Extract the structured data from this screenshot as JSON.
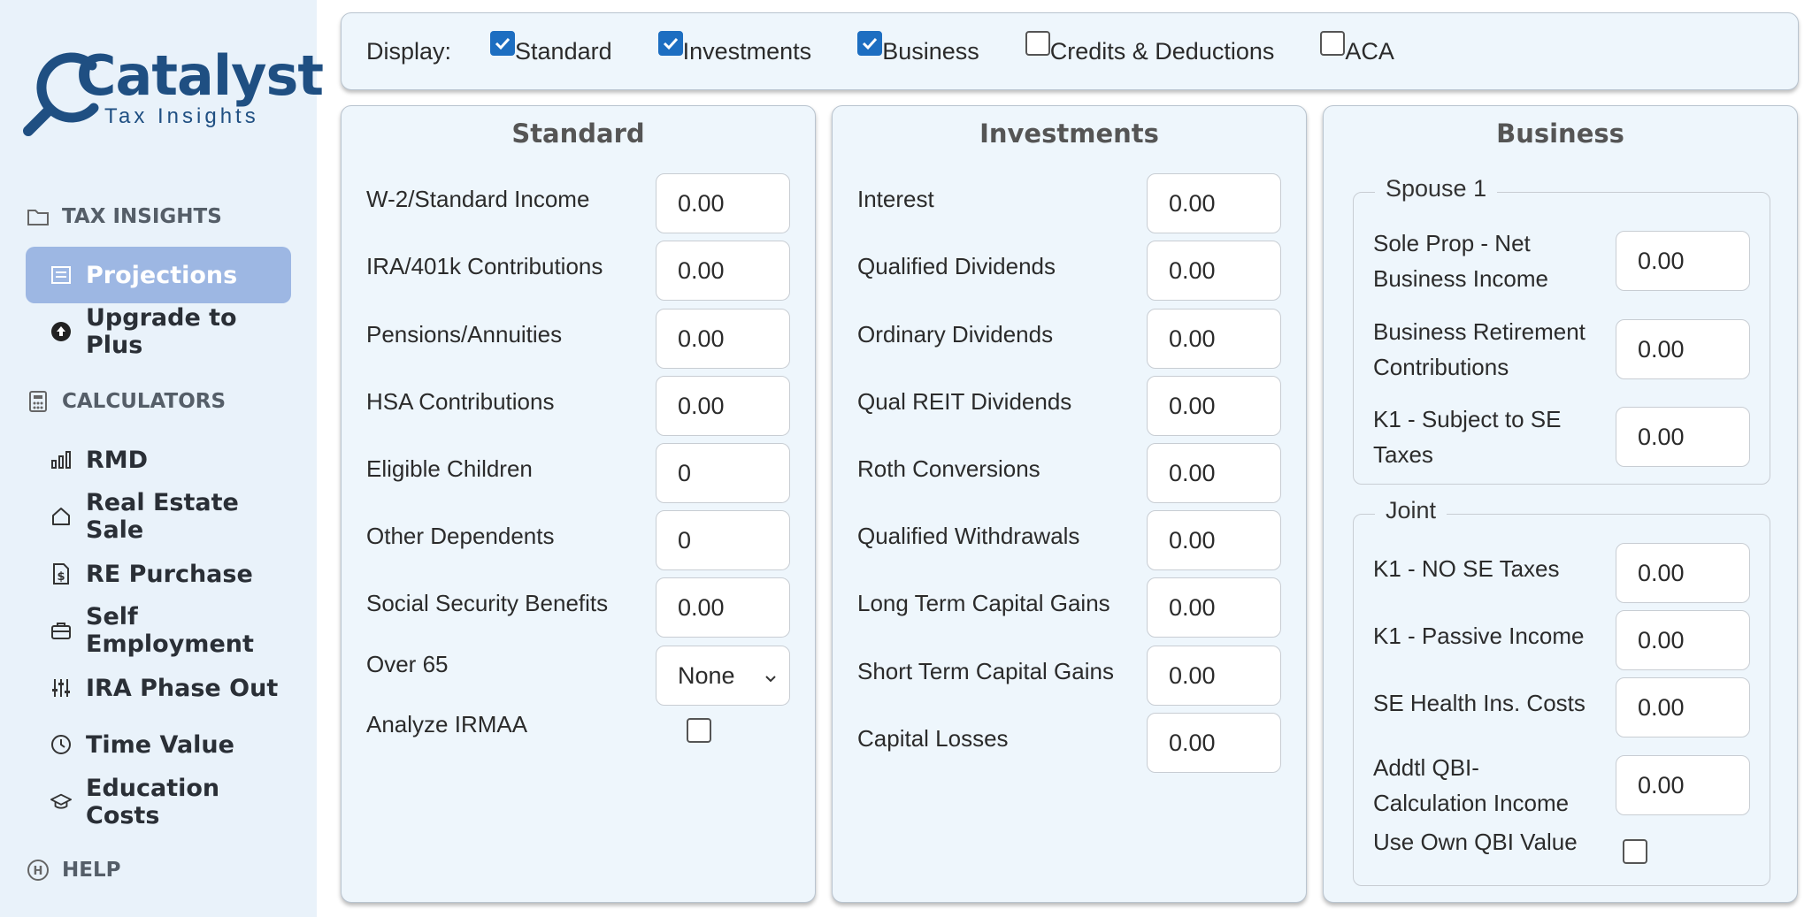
{
  "brand": {
    "name": "Catalyst",
    "tagline": "Tax Insights"
  },
  "sidebar": {
    "sections": [
      {
        "label": "TAX INSIGHTS",
        "icon": "folder-icon"
      },
      {
        "label": "CALCULATORS",
        "icon": "calculator-icon"
      },
      {
        "label": "HELP",
        "icon": "help-circle-icon"
      }
    ],
    "items": [
      {
        "label": "Projections",
        "icon": "document-icon",
        "active": true
      },
      {
        "label": "Upgrade to Plus",
        "icon": "upgrade-arrow-icon"
      },
      {
        "label": "RMD",
        "icon": "bar-chart-icon"
      },
      {
        "label": "Real Estate Sale",
        "icon": "house-icon"
      },
      {
        "label": "RE Purchase",
        "icon": "dollar-file-icon"
      },
      {
        "label": "Self Employment",
        "icon": "briefcase-icon"
      },
      {
        "label": "IRA Phase Out",
        "icon": "sliders-icon"
      },
      {
        "label": "Time Value",
        "icon": "clock-icon"
      },
      {
        "label": "Education Costs",
        "icon": "graduation-cap-icon"
      }
    ]
  },
  "display": {
    "label": "Display:",
    "options": [
      {
        "label": "Standard",
        "checked": true
      },
      {
        "label": "Investments",
        "checked": true
      },
      {
        "label": "Business",
        "checked": true
      },
      {
        "label": "Credits & Deductions",
        "checked": false
      },
      {
        "label": "ACA",
        "checked": false
      }
    ]
  },
  "standard": {
    "title": "Standard",
    "fields": [
      {
        "label": "W-2/Standard Income",
        "value": "0.00"
      },
      {
        "label": "IRA/401k Contributions",
        "value": "0.00"
      },
      {
        "label": "Pensions/Annuities",
        "value": "0.00"
      },
      {
        "label": "HSA Contributions",
        "value": "0.00"
      },
      {
        "label": "Eligible Children",
        "value": "0"
      },
      {
        "label": "Other Dependents",
        "value": "0"
      },
      {
        "label": "Social Security Benefits",
        "value": "0.00"
      }
    ],
    "over65": {
      "label": "Over 65",
      "value": "None"
    },
    "irmaa": {
      "label": "Analyze IRMAA",
      "checked": false
    }
  },
  "investments": {
    "title": "Investments",
    "fields": [
      {
        "label": "Interest",
        "value": "0.00"
      },
      {
        "label": "Qualified Dividends",
        "value": "0.00"
      },
      {
        "label": "Ordinary Dividends",
        "value": "0.00"
      },
      {
        "label": "Qual REIT Dividends",
        "value": "0.00"
      },
      {
        "label": "Roth Conversions",
        "value": "0.00"
      },
      {
        "label": "Qualified Withdrawals",
        "value": "0.00"
      },
      {
        "label": "Long Term Capital Gains",
        "value": "0.00"
      },
      {
        "label": "Short Term Capital Gains",
        "value": "0.00"
      },
      {
        "label": "Capital Losses",
        "value": "0.00"
      }
    ]
  },
  "business": {
    "title": "Business",
    "spouse1": {
      "legend": "Spouse 1",
      "fields": [
        {
          "label_line1": "Sole Prop - Net",
          "label_line2": "Business Income",
          "value": "0.00"
        },
        {
          "label_line1": "Business Retirement",
          "label_line2": "Contributions",
          "value": "0.00"
        },
        {
          "label_line1": "K1 - Subject to SE",
          "label_line2": "Taxes",
          "value": "0.00"
        }
      ]
    },
    "joint": {
      "legend": "Joint",
      "fields": [
        {
          "label": "K1 - NO SE Taxes",
          "value": "0.00"
        },
        {
          "label": "K1 - Passive Income",
          "value": "0.00"
        },
        {
          "label": "SE Health Ins. Costs",
          "value": "0.00"
        }
      ],
      "qbi": {
        "label_line1": "Addtl QBI-",
        "label_line2": "Calculation Income",
        "value": "0.00"
      },
      "own_qbi": {
        "label": "Use Own QBI Value",
        "checked": false
      }
    }
  },
  "colors": {
    "accent": "#9db7e3",
    "brand": "#1f4f82",
    "checkbox": "#1d6ec1",
    "panel": "#eef6fc",
    "sidebar": "#e9f2fa"
  }
}
